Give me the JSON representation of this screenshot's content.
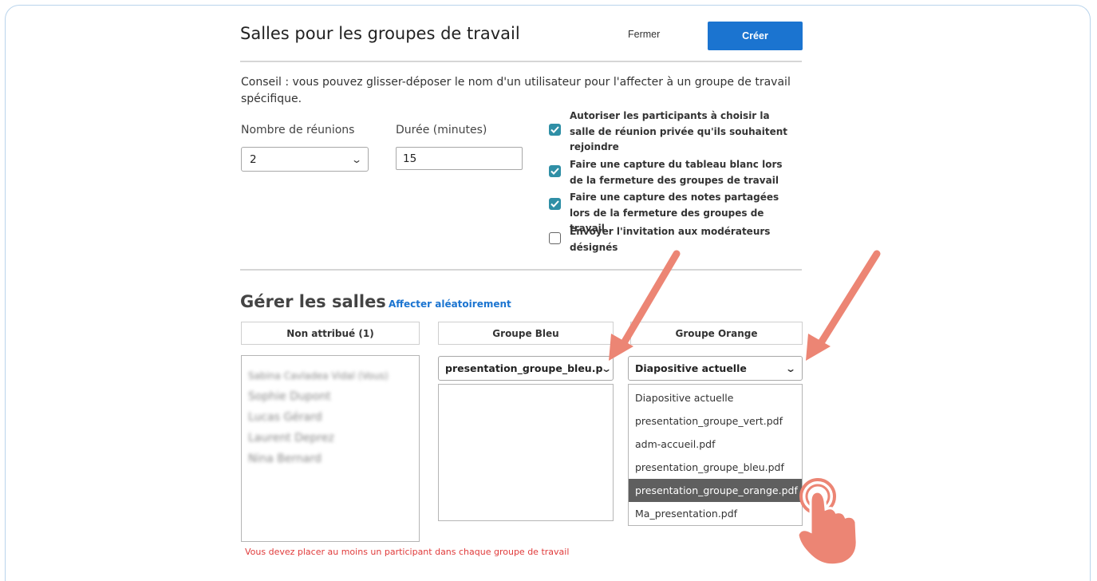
{
  "dialog": {
    "title": "Salles pour les groupes de travail",
    "close_label": "Fermer",
    "create_label": "Créer",
    "tip": "Conseil : vous pouvez glisser-déposer le nom d'un utilisateur pour l'affecter à un groupe de travail spécifique."
  },
  "settings": {
    "rooms_label": "Nombre de réunions",
    "rooms_value": "2",
    "duration_label": "Durée (minutes)",
    "duration_value": "15"
  },
  "options": [
    {
      "label": "Autoriser les participants à choisir la salle de réunion privée qu'ils souhaitent rejoindre",
      "checked": true
    },
    {
      "label": "Faire une capture du tableau blanc lors de la fermeture des groupes de travail",
      "checked": true
    },
    {
      "label": "Faire une capture des notes partagées lors de la fermeture des groupes de travail",
      "checked": true
    },
    {
      "label": "Envoyer l'invitation aux modérateurs désignés",
      "checked": false
    }
  ],
  "manage": {
    "title": "Gérer les salles",
    "shuffle_label": "Affecter aléatoirement",
    "columns": [
      {
        "header": "Non attribué (1)"
      },
      {
        "header": "Groupe Bleu",
        "selected_file": "presentation_groupe_bleu.p"
      },
      {
        "header": "Groupe Orange",
        "selected_file": "Diapositive actuelle"
      }
    ],
    "unassigned_users": [
      "Sabina Cavladea Vidal (Vous)",
      "Sophie Dupont",
      "Lucas Gérard",
      "Laurent Deprez",
      "Nina Bernard"
    ],
    "dropdown_options": [
      {
        "label": "Diapositive actuelle",
        "selected": false
      },
      {
        "label": "presentation_groupe_vert.pdf",
        "selected": false
      },
      {
        "label": "adm-accueil.pdf",
        "selected": false
      },
      {
        "label": "presentation_groupe_bleu.pdf",
        "selected": false
      },
      {
        "label": "presentation_groupe_orange.pdf",
        "selected": true
      },
      {
        "label": "Ma_presentation.pdf",
        "selected": false
      }
    ],
    "error_text": "Vous devez placer au moins un participant dans chaque groupe de travail"
  },
  "colors": {
    "primary": "#1b74d0",
    "checkbox": "#2f8fa6",
    "error": "#e03b3b",
    "annotation_arrow": "#ec8574",
    "selected_option_bg": "#5f5f5f"
  }
}
